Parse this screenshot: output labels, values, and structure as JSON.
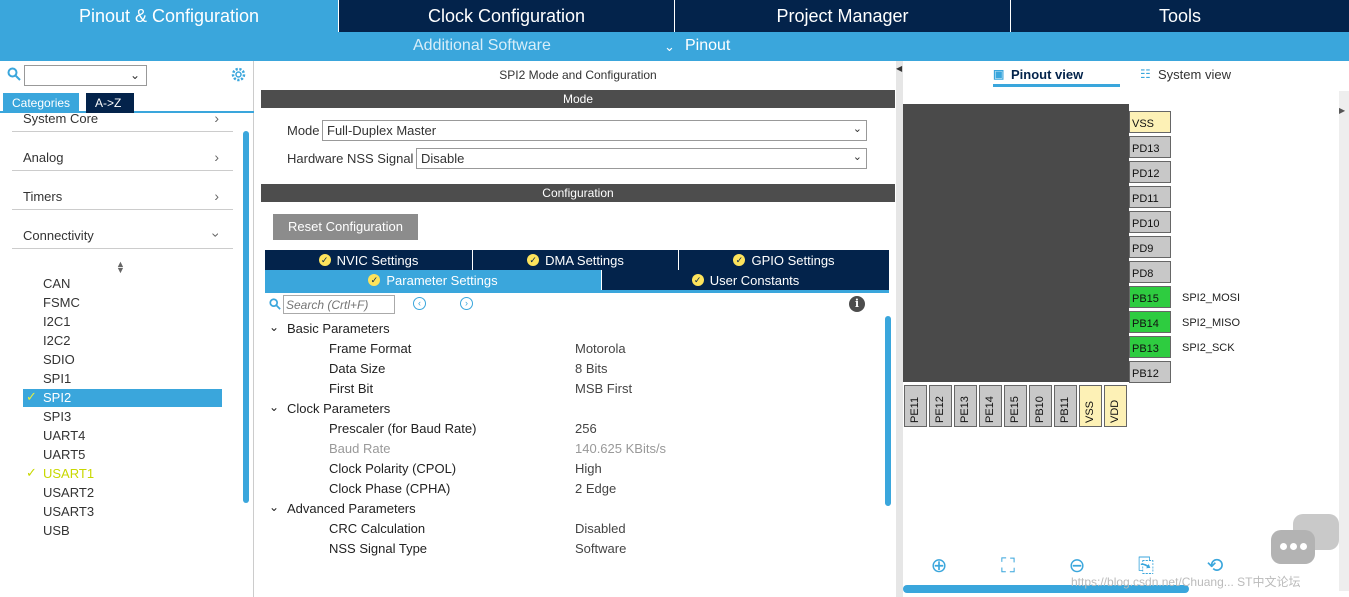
{
  "top_tabs": [
    "Pinout & Configuration",
    "Clock Configuration",
    "Project Manager",
    "Tools"
  ],
  "sub_menu": {
    "additional_software": "Additional Software",
    "pinout": "Pinout",
    "pinout_chevron": "chevron-down-icon"
  },
  "sidebar": {
    "category_tabs": [
      "Categories",
      "A->Z"
    ],
    "groups": [
      "System Core",
      "Analog",
      "Timers",
      "Connectivity"
    ],
    "connectivity_items": [
      "CAN",
      "FSMC",
      "I2C1",
      "I2C2",
      "SDIO",
      "SPI1",
      "SPI2",
      "SPI3",
      "UART4",
      "UART5",
      "USART1",
      "USART2",
      "USART3",
      "USB"
    ],
    "selected_item": "SPI2",
    "checked_items": [
      "SPI2",
      "USART1"
    ]
  },
  "config": {
    "title": "SPI2 Mode and Configuration",
    "mode_header": "Mode",
    "mode_label": "Mode",
    "mode_value": "Full-Duplex Master",
    "nss_label": "Hardware NSS Signal",
    "nss_value": "Disable",
    "configuration_header": "Configuration",
    "reset_button": "Reset Configuration",
    "tabs_row1": [
      "NVIC Settings",
      "DMA Settings",
      "GPIO Settings"
    ],
    "tabs_row2": [
      "Parameter Settings",
      "User Constants"
    ],
    "search_placeholder": "Search (Crtl+F)",
    "sections": [
      {
        "title": "Basic Parameters",
        "params": [
          {
            "name": "Frame Format",
            "value": "Motorola"
          },
          {
            "name": "Data Size",
            "value": "8 Bits"
          },
          {
            "name": "First Bit",
            "value": "MSB First"
          }
        ]
      },
      {
        "title": "Clock Parameters",
        "params": [
          {
            "name": "Prescaler (for Baud Rate)",
            "value": "256"
          },
          {
            "name": "Baud Rate",
            "value": "140.625 KBits/s"
          },
          {
            "name": "Clock Polarity (CPOL)",
            "value": "High"
          },
          {
            "name": "Clock Phase (CPHA)",
            "value": "2 Edge"
          }
        ]
      },
      {
        "title": "Advanced Parameters",
        "params": [
          {
            "name": "CRC Calculation",
            "value": "Disabled"
          },
          {
            "name": "NSS Signal Type",
            "value": "Software"
          }
        ]
      }
    ]
  },
  "pinout": {
    "view_tabs": [
      "Pinout view",
      "System view"
    ],
    "right_pins": [
      {
        "pin": "VSS",
        "signal": ""
      },
      {
        "pin": "PD13",
        "signal": ""
      },
      {
        "pin": "PD12",
        "signal": ""
      },
      {
        "pin": "PD11",
        "signal": ""
      },
      {
        "pin": "PD10",
        "signal": ""
      },
      {
        "pin": "PD9",
        "signal": ""
      },
      {
        "pin": "PD8",
        "signal": ""
      },
      {
        "pin": "PB15",
        "signal": "SPI2_MOSI"
      },
      {
        "pin": "PB14",
        "signal": "SPI2_MISO"
      },
      {
        "pin": "PB13",
        "signal": "SPI2_SCK"
      },
      {
        "pin": "PB12",
        "signal": ""
      }
    ],
    "bottom_pins": [
      "PE11",
      "PE12",
      "PE13",
      "PE14",
      "PE15",
      "PB10",
      "PB11",
      "VSS",
      "VDD"
    ],
    "green_pins": [
      "PB15",
      "PB14",
      "PB13"
    ],
    "power_pins": [
      "VSS",
      "VDD"
    ],
    "toolbar_icons": [
      "zoom-in-icon",
      "fit-screen-icon",
      "zoom-out-icon",
      "export-icon",
      "rotate-icon"
    ]
  },
  "watermark": "https://blog.csdn.net/Chuang... ST中文论坛",
  "colors": {
    "dark_navy": "#03234b",
    "accent_blue": "#3aa6dc",
    "pin_green": "#2ecc40",
    "check_yellow": "#c8d800",
    "power_pin": "#fdf1b6"
  }
}
